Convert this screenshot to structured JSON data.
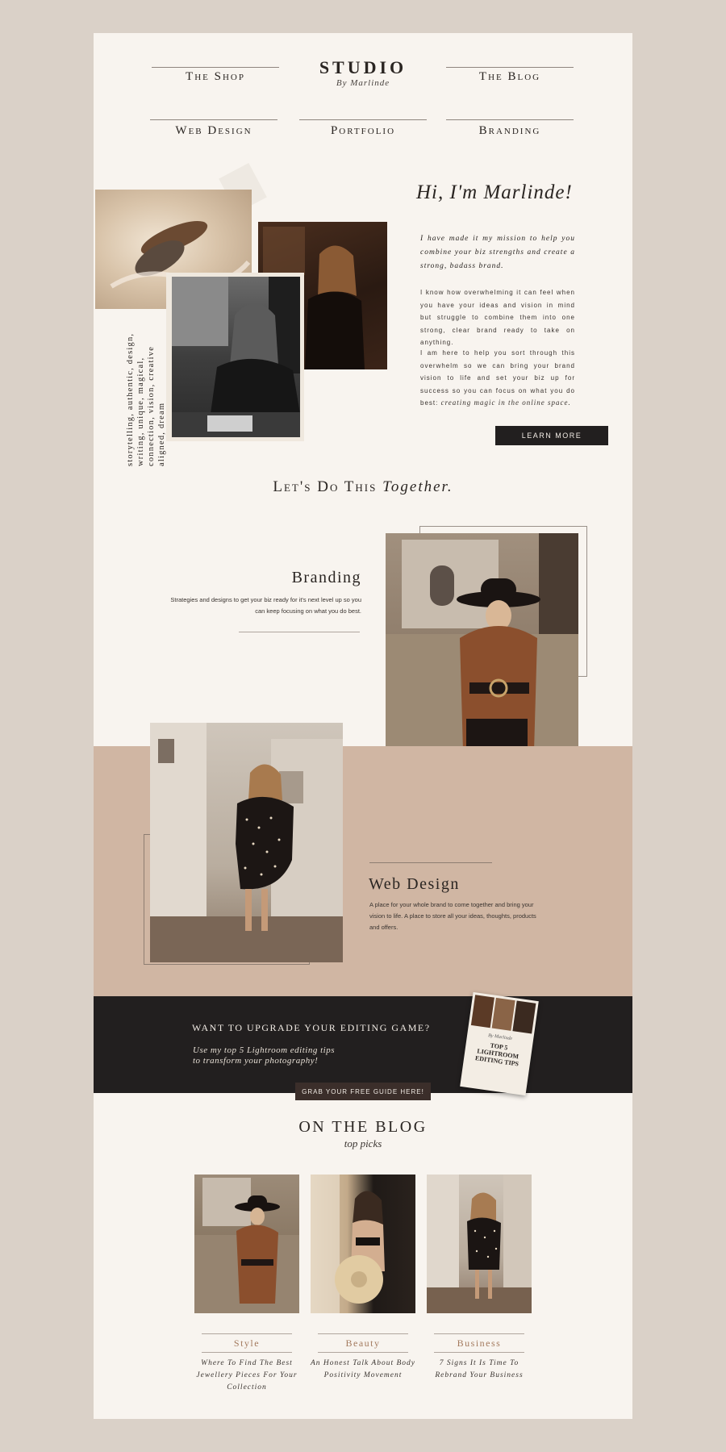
{
  "header": {
    "logo_title": "STUDIO",
    "logo_script": "By Marlinde",
    "nav": {
      "shop": "The Shop",
      "blog": "The Blog",
      "web_design": "Web Design",
      "portfolio": "Portfolio",
      "branding": "Branding"
    }
  },
  "hero": {
    "vertical_words_1": "storytelling, authentic, design,",
    "vertical_words_2": "writing, unique, magical,",
    "vertical_words_3": "connection, vision, creative",
    "vertical_words_4": "aligned, dream",
    "greeting": "Hi, I'm Marlinde!",
    "lead": "I have made it my mission to help you combine your biz strengths and create a strong, badass brand.",
    "para1": "I know how overwhelming it can feel when you have your ideas and vision in mind but struggle to combine them into one strong, clear brand ready to take on anything.",
    "para2_prefix": "I am here to help you sort through this overwhelm so we can bring your brand vision to life and set your biz up for success so you can focus on what you do best: ",
    "para2_italic": "creating magic in the online space.",
    "cta": "LEARN MORE"
  },
  "together": {
    "prefix": "Let's Do This ",
    "emphasis": "Together."
  },
  "services": {
    "branding": {
      "title": "Branding",
      "desc": "Strategies and designs to get your biz ready for it's next level up so you can keep focusing on what you do best."
    },
    "web_design": {
      "title": "Web Design",
      "desc": "A place for your whole brand to come together and bring your vision to life. A place to store all your ideas, thoughts, products and offers."
    }
  },
  "promo": {
    "heading": "WANT TO UPGRADE YOUR EDITING GAME?",
    "line1": "Use my top 5 Lightroom editing tips",
    "line2": "to transform your photography!",
    "cta": "GRAB YOUR FREE GUIDE HERE!",
    "card_script": "By Marlinde",
    "card_title": "TOP 5 LIGHTROOM EDITING TIPS"
  },
  "blog": {
    "title": "ON THE BLOG",
    "subtitle": "top picks",
    "posts": [
      {
        "category": "Style",
        "title": "Where To Find The Best Jewellery Pieces For Your Collection"
      },
      {
        "category": "Beauty",
        "title": "An Honest Talk About Body Positivity Movement"
      },
      {
        "category": "Business",
        "title": "7 Signs It Is Time To Rebrand Your Business"
      }
    ]
  },
  "colors": {
    "page_bg": "#f8f4ef",
    "outer_bg": "#dad1c8",
    "accent_tan": "#d0b6a3",
    "dark_band": "#221f1f",
    "category_brown": "#a37a5e"
  }
}
